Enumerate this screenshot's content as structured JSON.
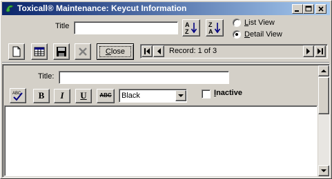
{
  "window": {
    "title": "Toxicall® Maintenance: Keycut Information"
  },
  "search": {
    "title_label": "Title",
    "title_value": "",
    "sort_az_label": "A↓Z",
    "sort_za_label": "Z↓A"
  },
  "view_mode": {
    "list_view_label": "List View",
    "detail_view_label": "Detail View",
    "selected": "Detail View"
  },
  "toolbar": {
    "close_label": "Close",
    "record_label": "Record: 1 of 3"
  },
  "detail": {
    "title_label": "Title:",
    "title_value": "",
    "bold_label": "B",
    "italic_label": "I",
    "underline_label": "U",
    "strike_label": "ABC",
    "spellcheck_label": "ABC",
    "color_value": "Black",
    "inactive_label": "Inactive",
    "inactive_checked": false,
    "body_text": ""
  },
  "colors": {
    "title_bar_start": "#0a246a",
    "title_bar_end": "#a6caf0",
    "face": "#d4d0c8"
  }
}
